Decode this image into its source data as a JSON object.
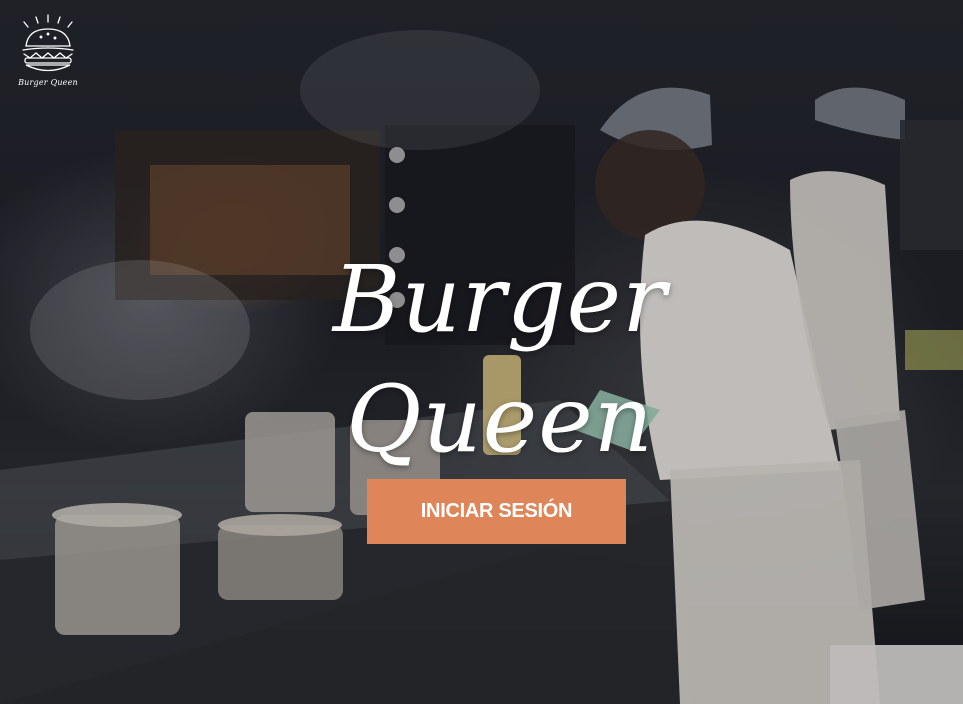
{
  "brand": {
    "logo_icon": "burger-icon",
    "logo_caption": "Burger Queen",
    "title": "Burger Queen"
  },
  "actions": {
    "login_label": "INICIAR SESIÓN"
  },
  "colors": {
    "button_bg": "#de865a",
    "text": "#ffffff"
  }
}
